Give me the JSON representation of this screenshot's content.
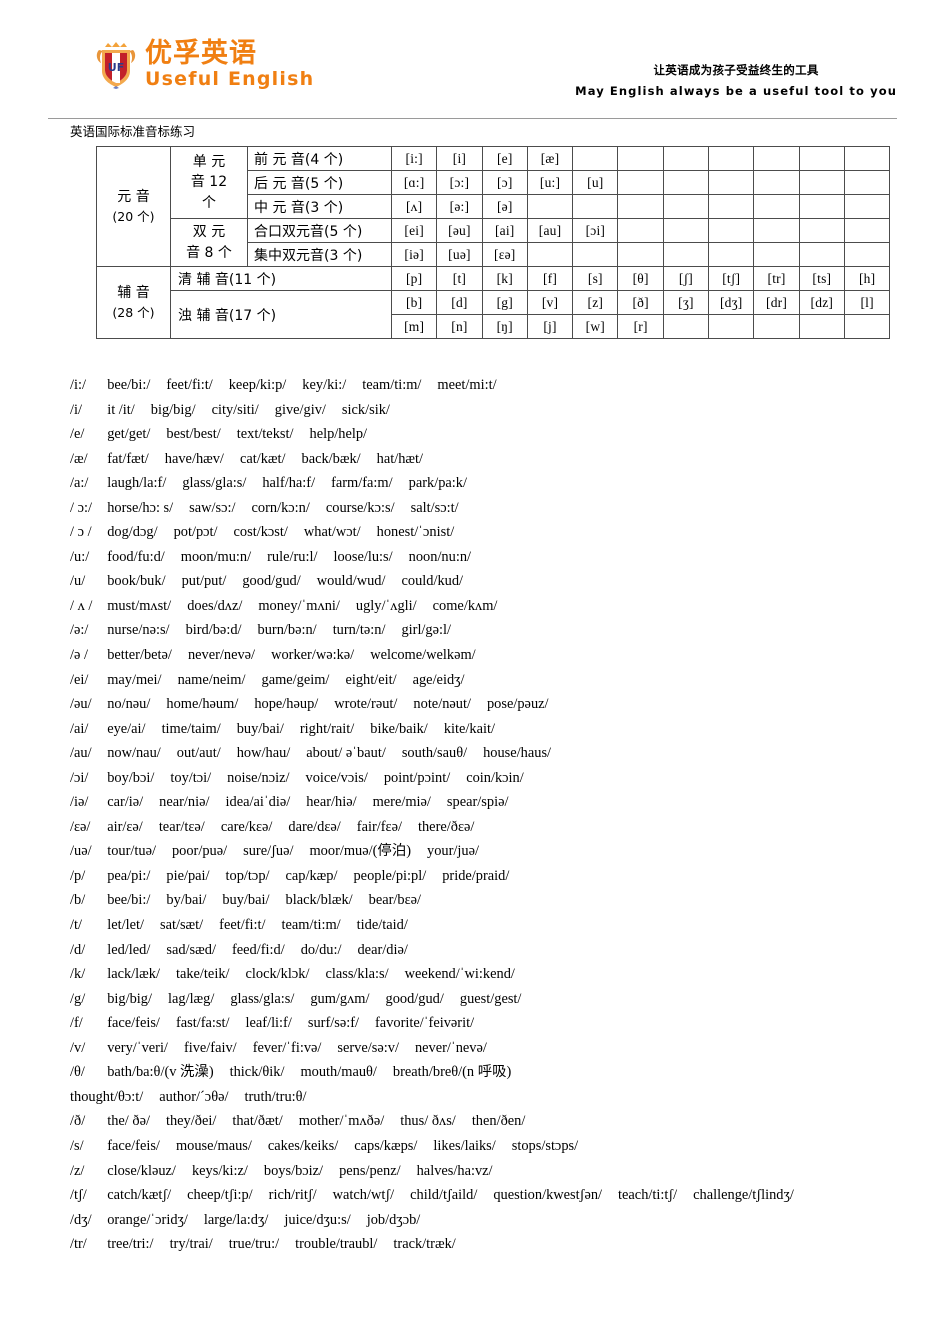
{
  "header": {
    "logo_cn": "优孚英语",
    "logo_en": "Useful English",
    "slogan_cn": "让英语成为孩子受益终生的工具",
    "slogan_en": "May English always be a useful tool to you",
    "brand_color": "#f07f12"
  },
  "doc_title": "英语国际标准音标练习",
  "table": {
    "vowels": {
      "label_line1": "元    音",
      "label_line2": "(20 个)",
      "mono_label": "单 元 音 12 个",
      "mono_l1": "单  元",
      "mono_l2": "音   12",
      "mono_l3": "个",
      "diph_l1": "双  元",
      "diph_l2": "音 8 个",
      "rows": [
        {
          "group": "前  元  音(4 个)",
          "symbols": [
            "[i:]",
            "[i]",
            "[e]",
            "[æ]",
            "",
            "",
            "",
            "",
            "",
            "",
            ""
          ]
        },
        {
          "group": "后  元  音(5 个)",
          "symbols": [
            "[ɑ:]",
            "[ɔ:]",
            "[ɔ]",
            "[u:]",
            "[u]",
            "",
            "",
            "",
            "",
            "",
            ""
          ]
        },
        {
          "group": "中  元  音(3 个)",
          "symbols": [
            "[ʌ]",
            "[ə:]",
            "[ə]",
            "",
            "",
            "",
            "",
            "",
            "",
            "",
            ""
          ]
        },
        {
          "group": "合口双元音(5 个)",
          "symbols": [
            "[ei]",
            "[əu]",
            "[ai]",
            "[au]",
            "[ɔi]",
            "",
            "",
            "",
            "",
            "",
            ""
          ]
        },
        {
          "group": "集中双元音(3 个)",
          "symbols": [
            "[iə]",
            "[uə]",
            "[ɛə]",
            "",
            "",
            "",
            "",
            "",
            "",
            "",
            ""
          ]
        }
      ]
    },
    "consonants": {
      "label_line1": "辅    音",
      "label_line2": "(28 个)",
      "voiceless_label": "清    辅    音(11 个)",
      "voiced_label": "浊    辅    音(17 个)",
      "rows": [
        {
          "symbols": [
            "[p]",
            "[t]",
            "[k]",
            "[f]",
            "[s]",
            "[θ]",
            "[ʃ]",
            "[tʃ]",
            "[tr]",
            "[ts]",
            "[h]"
          ]
        },
        {
          "symbols": [
            "[b]",
            "[d]",
            "[g]",
            "[v]",
            "[z]",
            "[ð]",
            "[ʒ]",
            "[dʒ]",
            "[dr]",
            "[dz]",
            "[l]"
          ]
        },
        {
          "symbols": [
            "[m]",
            "[n]",
            "[ŋ]",
            "[j]",
            "[w]",
            "[r]",
            "",
            "",
            "",
            "",
            ""
          ]
        }
      ]
    }
  },
  "wordlist": [
    {
      "ph": "/i:/",
      "words": [
        "bee/bi:/",
        "feet/fi:t/",
        "keep/ki:p/",
        "key/ki:/",
        "team/ti:m/",
        "meet/mi:t/"
      ]
    },
    {
      "ph": "/i/",
      "words": [
        "it /it/",
        "big/big/",
        "city/siti/",
        "give/giv/",
        "sick/sik/"
      ]
    },
    {
      "ph": "/e/",
      "words": [
        "get/get/",
        "best/best/",
        "text/tekst/",
        "help/help/"
      ]
    },
    {
      "ph": "/æ/",
      "words": [
        "fat/fæt/",
        "have/hæv/",
        "cat/kæt/",
        "back/bæk/",
        "hat/hæt/"
      ]
    },
    {
      "ph": "/a:/",
      "words": [
        "laugh/la:f/",
        "glass/gla:s/",
        "half/ha:f/",
        "farm/fa:m/",
        "park/pa:k/"
      ]
    },
    {
      "ph": "/ ɔ:/",
      "words": [
        "horse/hɔ: s/",
        "saw/sɔ:/",
        "corn/kɔ:n/",
        "course/kɔ:s/",
        "salt/sɔ:t/"
      ]
    },
    {
      "ph": "/ ɔ /",
      "words": [
        "dog/dɔg/",
        "pot/pɔt/",
        "cost/kɔst/",
        "what/wɔt/",
        "honest/ˈɔnist/"
      ]
    },
    {
      "ph": "/u:/",
      "words": [
        "food/fu:d/",
        "moon/mu:n/",
        "rule/ru:l/",
        "loose/lu:s/",
        "noon/nu:n/"
      ]
    },
    {
      "ph": "/u/",
      "words": [
        "book/buk/",
        "put/put/",
        "good/gud/",
        "would/wud/",
        "could/kud/"
      ]
    },
    {
      "ph": "/ ʌ /",
      "words": [
        "must/mʌst/",
        "does/dʌz/",
        "money/ˈmʌni/",
        "ugly/ˈʌgli/",
        "come/kʌm/"
      ]
    },
    {
      "ph": "/ə:/",
      "words": [
        "nurse/nə:s/",
        "bird/bə:d/",
        "burn/bə:n/",
        "turn/tə:n/",
        "girl/gə:l/"
      ]
    },
    {
      "ph": "/ə /",
      "words": [
        "better/betə/",
        "never/nevə/",
        "worker/wə:kə/",
        "welcome/welkəm/"
      ]
    },
    {
      "ph": "/ei/",
      "words": [
        "may/mei/",
        "name/neim/",
        "game/geim/",
        "eight/eit/",
        "age/eidʒ/"
      ]
    },
    {
      "ph": "/əu/",
      "words": [
        "no/nəu/",
        "home/həum/",
        "hope/həup/",
        "wrote/rəut/",
        "note/nəut/",
        "pose/pəuz/"
      ]
    },
    {
      "ph": "/ai/",
      "words": [
        "eye/ai/",
        "time/taim/",
        "buy/bai/",
        "right/rait/",
        "bike/baik/",
        "kite/kait/"
      ]
    },
    {
      "ph": "/au/",
      "words": [
        "now/nau/",
        "out/aut/",
        "how/hau/",
        "about/ əˈbaut/",
        "south/sauθ/",
        "house/haus/"
      ]
    },
    {
      "ph": "/ɔi/",
      "words": [
        "boy/bɔi/",
        "toy/tɔi/",
        "noise/nɔiz/",
        "voice/vɔis/",
        "point/pɔint/",
        "coin/kɔin/"
      ]
    },
    {
      "ph": "/iə/",
      "words": [
        "car/iə/",
        "near/niə/",
        "idea/aiˈdiə/",
        "hear/hiə/",
        "mere/miə/",
        "spear/spiə/"
      ]
    },
    {
      "ph": "/ɛə/",
      "words": [
        "air/ɛə/",
        "tear/tɛə/",
        "care/kɛə/",
        "dare/dɛə/",
        "fair/fɛə/",
        "there/ðɛə/"
      ]
    },
    {
      "ph": "/uə/",
      "words": [
        "tour/tuə/",
        "poor/puə/",
        "sure/ʃuə/",
        "moor/muə/(停泊)",
        "your/juə/"
      ]
    },
    {
      "ph": "/p/",
      "words": [
        "pea/pi:/",
        "pie/pai/",
        "top/tɔp/",
        "cap/kæp/",
        "people/pi:pl/",
        "pride/praid/"
      ]
    },
    {
      "ph": "/b/",
      "words": [
        "bee/bi:/",
        "by/bai/",
        "buy/bai/",
        "black/blæk/",
        "bear/bɛə/"
      ]
    },
    {
      "ph": "/t/",
      "words": [
        "let/let/",
        "sat/sæt/",
        "feet/fi:t/",
        "team/ti:m/",
        "tide/taid/"
      ]
    },
    {
      "ph": "/d/",
      "words": [
        "led/led/",
        "sad/sæd/",
        "feed/fi:d/",
        "do/du:/",
        "dear/diə/"
      ]
    },
    {
      "ph": "/k/",
      "words": [
        "lack/læk/",
        "take/teik/",
        "clock/klɔk/",
        "class/kla:s/",
        "weekend/ˈwi:kend/"
      ]
    },
    {
      "ph": "/g/",
      "words": [
        "big/big/",
        "lag/læg/",
        "glass/gla:s/",
        "gum/gʌm/",
        "good/gud/",
        "guest/gest/"
      ]
    },
    {
      "ph": "/f/",
      "words": [
        "face/feis/",
        "fast/fa:st/",
        "leaf/li:f/",
        "surf/sə:f/",
        "favorite/ˈfeivərit/"
      ]
    },
    {
      "ph": "/v/",
      "words": [
        "very/ˈveri/",
        "five/faiv/",
        "fever/ˈfi:və/",
        "serve/sə:v/",
        "never/ˈnevə/"
      ]
    },
    {
      "ph": "/θ/",
      "words": [
        "bath/ba:θ/(v 洗澡)",
        "thick/θik/",
        "mouth/mauθ/",
        "breath/breθ/(n 呼吸)"
      ]
    },
    {
      "ph": "",
      "words": [
        "thought/θɔ:t/",
        "author/ˊɔθə/",
        "truth/tru:θ/"
      ]
    },
    {
      "ph": "/ð/",
      "words": [
        "the/ ðə/",
        "they/ðei/",
        "that/ðæt/",
        "mother/ˈmʌðə/",
        "thus/ ðʌs/",
        "then/ðen/"
      ]
    },
    {
      "ph": "/s/",
      "words": [
        "face/feis/",
        "mouse/maus/",
        "cakes/keiks/",
        "caps/kæps/",
        "likes/laiks/",
        "stops/stɔps/"
      ]
    },
    {
      "ph": "/z/",
      "words": [
        "close/kləuz/",
        "keys/ki:z/",
        "boys/bɔiz/",
        "pens/penz/",
        "halves/ha:vz/"
      ]
    },
    {
      "ph": "/tʃ/",
      "words": [
        "catch/kætʃ/",
        "cheep/tʃi:p/",
        "rich/ritʃ/",
        "watch/wtʃ/",
        "child/tʃaild/",
        "question/kwestʃən/",
        "teach/ti:tʃ/",
        "challenge/tʃlindʒ/"
      ]
    },
    {
      "ph": "/dʒ/",
      "words": [
        "orange/ˈɔridʒ/",
        "large/la:dʒ/",
        "juice/dʒu:s/",
        "job/dʒɔb/"
      ]
    },
    {
      "ph": "/tr/",
      "words": [
        "tree/tri:/",
        "try/trai/",
        "true/tru:/",
        "trouble/traubl/",
        "track/træk/"
      ]
    }
  ]
}
